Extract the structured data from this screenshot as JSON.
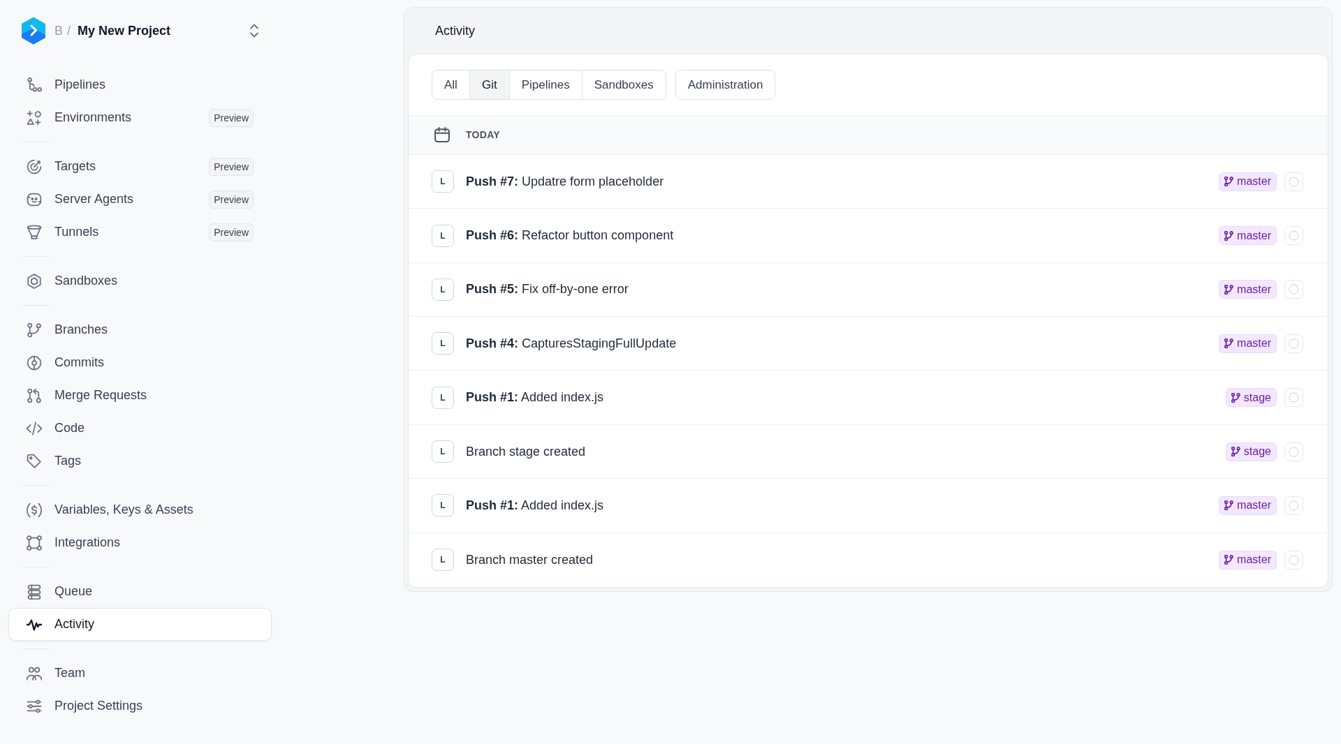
{
  "sidebar": {
    "workspace": "B",
    "separator": "/",
    "project": "My New Project",
    "groups": [
      {
        "items": [
          {
            "label": "Pipelines",
            "selected": false
          },
          {
            "label": "Environments",
            "badge": "Preview",
            "selected": false
          }
        ]
      },
      {
        "items": [
          {
            "label": "Targets",
            "badge": "Preview",
            "selected": false
          },
          {
            "label": "Server Agents",
            "badge": "Preview",
            "selected": false
          },
          {
            "label": "Tunnels",
            "badge": "Preview",
            "selected": false
          }
        ]
      },
      {
        "items": [
          {
            "label": "Sandboxes",
            "selected": false
          }
        ]
      },
      {
        "items": [
          {
            "label": "Branches",
            "selected": false
          },
          {
            "label": "Commits",
            "selected": false
          },
          {
            "label": "Merge Requests",
            "selected": false
          },
          {
            "label": "Code",
            "selected": false
          },
          {
            "label": "Tags",
            "selected": false
          }
        ]
      },
      {
        "items": [
          {
            "label": "Variables, Keys & Assets",
            "selected": false
          },
          {
            "label": "Integrations",
            "selected": false
          }
        ]
      },
      {
        "items": [
          {
            "label": "Queue",
            "selected": false
          },
          {
            "label": "Activity",
            "selected": true
          }
        ]
      },
      {
        "items": [
          {
            "label": "Team",
            "selected": false
          },
          {
            "label": "Project Settings",
            "selected": false
          }
        ]
      }
    ]
  },
  "main": {
    "title": "Activity",
    "filter_groups": [
      {
        "tabs": [
          {
            "label": "All",
            "selected": false
          },
          {
            "label": "Git",
            "selected": true
          },
          {
            "label": "Pipelines",
            "selected": false
          },
          {
            "label": "Sandboxes",
            "selected": false
          }
        ]
      },
      {
        "tabs": [
          {
            "label": "Administration",
            "selected": false
          }
        ]
      }
    ],
    "date_label": "TODAY",
    "events": [
      {
        "avatar": "L",
        "text": "**Push #7:** Updatre form placeholder",
        "branch": "master"
      },
      {
        "avatar": "L",
        "text": "**Push #6:** Refactor button component",
        "branch": "master"
      },
      {
        "avatar": "L",
        "text": "**Push #5:** Fix off-by-one error",
        "branch": "master"
      },
      {
        "avatar": "L",
        "text": "**Push #4:** CapturesStagingFullUpdate",
        "branch": "master"
      },
      {
        "avatar": "L",
        "text": "**Push #1:** Added index.js",
        "branch": "stage"
      },
      {
        "avatar": "L",
        "text": "Branch stage created",
        "branch": "stage"
      },
      {
        "avatar": "L",
        "text": "**Push #1:** Added index.js",
        "branch": "master"
      },
      {
        "avatar": "L",
        "text": "Branch master created",
        "branch": "master"
      }
    ]
  }
}
